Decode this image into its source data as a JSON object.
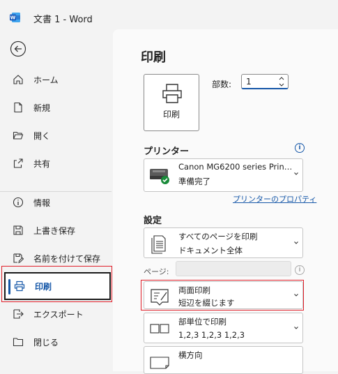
{
  "window": {
    "title": "文書 1  -  Word"
  },
  "sidebar": {
    "back_label": "back",
    "items": [
      {
        "label": "ホーム",
        "icon": "home-icon"
      },
      {
        "label": "新規",
        "icon": "new-document-icon"
      },
      {
        "label": "開く",
        "icon": "folder-open-icon"
      },
      {
        "label": "共有",
        "icon": "share-icon"
      },
      {
        "label": "情報",
        "icon": "info-icon"
      },
      {
        "label": "上書き保存",
        "icon": "save-icon"
      },
      {
        "label": "名前を付けて保存",
        "icon": "save-as-icon"
      },
      {
        "label": "印刷",
        "icon": "printer-icon",
        "active": true
      },
      {
        "label": "エクスポート",
        "icon": "export-icon"
      },
      {
        "label": "閉じる",
        "icon": "close-folder-icon"
      }
    ]
  },
  "main": {
    "title": "印刷",
    "print_button_label": "印刷",
    "copies_label": "部数:",
    "copies_value": "1",
    "printer_section": "プリンター",
    "printer_name": "Canon MG6200 series Prin…",
    "printer_status": "準備完了",
    "printer_properties_link": "プリンターのプロパティ",
    "settings_section": "設定",
    "settings": [
      {
        "line1": "すべてのページを印刷",
        "line2": "ドキュメント全体"
      },
      {
        "line1": "両面印刷",
        "line2": "短辺を綴じます"
      },
      {
        "line1": "部単位で印刷",
        "line2": "1,2,3    1,2,3    1,2,3"
      },
      {
        "line1": "横方向",
        "line2": ""
      }
    ],
    "pages_label": "ページ:",
    "pages_value": ""
  },
  "colors": {
    "accent": "#1557a8",
    "highlight": "#e0202a"
  }
}
